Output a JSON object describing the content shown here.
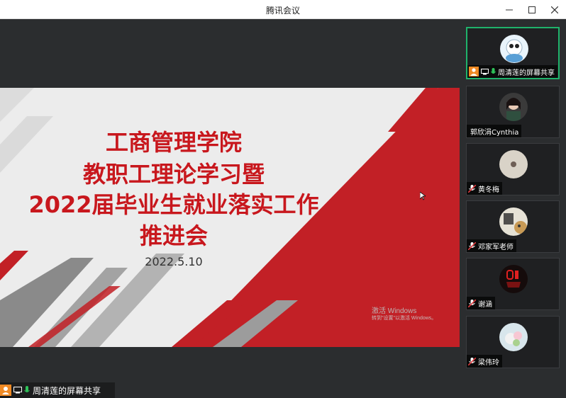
{
  "window": {
    "title": "腾讯会议"
  },
  "slide": {
    "line1": "工商管理学院",
    "line2": "教职工理论学习暨",
    "line3": "2022届毕业生就业落实工作",
    "line4": "推进会",
    "date": "2022.5.10",
    "watermark_title": "激活 Windows",
    "watermark_sub": "转到\"设置\"以激活 Windows。"
  },
  "share_bar": {
    "label": "周清莲的屏幕共享"
  },
  "participants": [
    {
      "name": "周清莲的屏幕共享",
      "status": "sharing",
      "avatar_color": "#e9f4fb"
    },
    {
      "name": "郭欣涓Cynthia",
      "status": "none",
      "avatar_color": "#3a3a3a"
    },
    {
      "name": "黄冬梅",
      "status": "muted",
      "avatar_color": "#d9d3c8"
    },
    {
      "name": "邓家军老师",
      "status": "muted",
      "avatar_color": "#e6e2d6"
    },
    {
      "name": "谢涵",
      "status": "muted",
      "avatar_color": "#150b0b"
    },
    {
      "name": "梁伟玲",
      "status": "muted",
      "avatar_color": "#d8e6ec"
    }
  ],
  "colors": {
    "accent_green": "#1fb36b",
    "slide_red": "#c8171d",
    "mute_red": "#e0393c"
  }
}
